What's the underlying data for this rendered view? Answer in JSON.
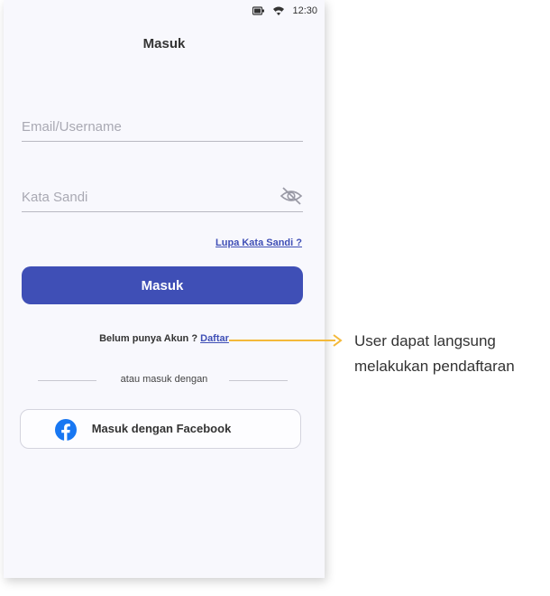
{
  "status_bar": {
    "time": "12:30"
  },
  "header": {
    "title": "Masuk"
  },
  "form": {
    "email_placeholder": "Email/Username",
    "password_placeholder": "Kata Sandi",
    "forgot_label": "Lupa Kata Sandi ?",
    "login_label": "Masuk"
  },
  "signup": {
    "prompt": "Belum punya Akun ?",
    "link_label": "Daftar"
  },
  "divider": {
    "label": "atau masuk dengan"
  },
  "social": {
    "facebook_label": "Masuk dengan Facebook"
  },
  "annotation": {
    "text": "User dapat langsung melakukan pendaftaran"
  },
  "colors": {
    "primary": "#3f4fb6",
    "annotation": "#f4b93a",
    "facebook": "#1877f2"
  },
  "icons": [
    "battery-icon",
    "wifi-icon",
    "eye-off-icon",
    "facebook-icon",
    "arrow-right-icon"
  ]
}
